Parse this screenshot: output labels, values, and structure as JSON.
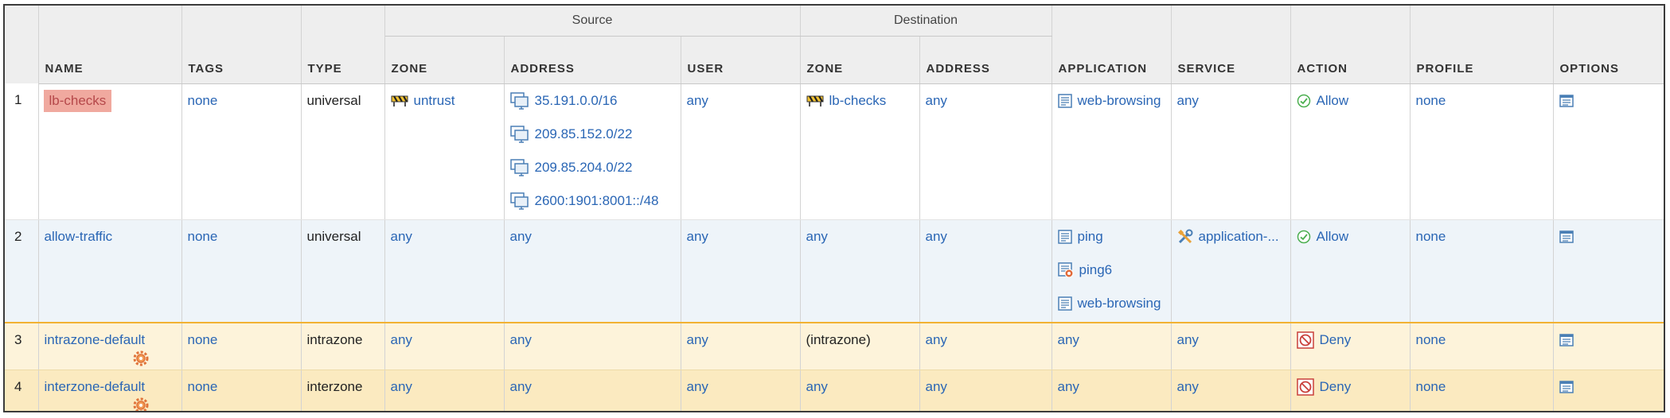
{
  "columns": {
    "group_source": "Source",
    "group_destination": "Destination",
    "name": "NAME",
    "tags": "TAGS",
    "type": "TYPE",
    "src_zone": "ZONE",
    "src_address": "ADDRESS",
    "src_user": "USER",
    "dst_zone": "ZONE",
    "dst_address": "ADDRESS",
    "application": "APPLICATION",
    "service": "SERVICE",
    "action": "ACTION",
    "profile": "PROFILE",
    "options": "OPTIONS"
  },
  "rules": [
    {
      "index": "1",
      "name": "lb-checks",
      "tags": "none",
      "type": "universal",
      "src_zone": "untrust",
      "src_addresses": [
        "35.191.0.0/16",
        "209.85.152.0/22",
        "209.85.204.0/22",
        "2600:1901:8001::/48"
      ],
      "src_user": "any",
      "dst_zone": "lb-checks",
      "dst_address": "any",
      "applications": [
        "web-browsing"
      ],
      "service": "any",
      "action": "Allow",
      "profile": "none"
    },
    {
      "index": "2",
      "name": "allow-traffic",
      "tags": "none",
      "type": "universal",
      "src_zone": "any",
      "src_address": "any",
      "src_user": "any",
      "dst_zone": "any",
      "dst_address": "any",
      "applications": [
        "ping",
        "ping6",
        "web-browsing"
      ],
      "service": "application-...",
      "action": "Allow",
      "profile": "none"
    },
    {
      "index": "3",
      "name": "intrazone-default",
      "tags": "none",
      "type": "intrazone",
      "src_zone": "any",
      "src_address": "any",
      "src_user": "any",
      "dst_zone": "(intrazone)",
      "dst_address": "any",
      "application": "any",
      "service": "any",
      "action": "Deny",
      "profile": "none"
    },
    {
      "index": "4",
      "name": "interzone-default",
      "tags": "none",
      "type": "interzone",
      "src_zone": "any",
      "src_address": "any",
      "src_user": "any",
      "dst_zone": "any",
      "dst_address": "any",
      "application": "any",
      "service": "any",
      "action": "Deny",
      "profile": "none"
    }
  ],
  "icons": {
    "zone": "zone-barrier-icon",
    "address": "address-monitor-icon",
    "application": "application-icon",
    "service": "service-tools-icon",
    "allow": "allow-check-icon",
    "deny": "deny-block-icon",
    "options": "options-icon",
    "default_rule": "default-rule-gear-icon"
  },
  "colors": {
    "link": "#2a66b5",
    "highlight": "#f0a99f",
    "allow": "#4caf50",
    "deny": "#c9403b",
    "row_selected_border": "#f2b233",
    "row_default_bg": "#fdf3da"
  }
}
